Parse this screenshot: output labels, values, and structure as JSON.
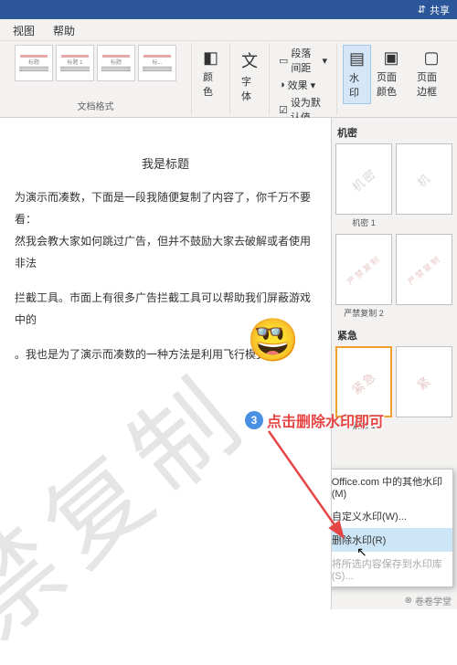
{
  "titlebar": {
    "share": "共享"
  },
  "menu": {
    "view": "视图",
    "help": "帮助"
  },
  "ribbon": {
    "style_gallery": [
      "标题",
      "标题 1",
      "标题",
      "标..."
    ],
    "doc_style_footer": "文档格式",
    "color": "颜色",
    "font": "字体",
    "para_spacing": "段落间距",
    "effect": "效果",
    "set_default": "设为默认值",
    "watermark": "水印",
    "page_color": "页面颜色",
    "page_border": "页面边框"
  },
  "doc": {
    "title": "我是标题",
    "line1": "为演示而凑数，下面是一段我随便复制了内容了，你千万不要看：",
    "line2": "然我会教大家如何跳过广告，但并不鼓励大家去破解或者使用非法",
    "line3": "拦截工具。市面上有很多广告拦截工具可以帮助我们屏蔽游戏中的",
    "line4": "。我也是为了演示而凑数的一种方法是利用飞行模式。↵",
    "bg_watermark": "禁复制"
  },
  "wm": {
    "section1": "机密",
    "thumb1_text": "机密",
    "thumb2_text": "机",
    "cap1": "机密 1",
    "thumb3_text": "严禁复制",
    "cap3": "严禁复制 2",
    "section2": "紧急",
    "thumb4_text": "紧急",
    "thumb5_text": "紧",
    "cap4": "紧急 1",
    "menu": {
      "more": "Office.com 中的其他水印(M)",
      "custom": "自定义水印(W)...",
      "remove": "删除水印(R)",
      "save": "将所选内容保存到水印库(S)..."
    }
  },
  "overlay": {
    "step_num": "3",
    "step_text": "点击删除水印即可"
  },
  "author": "卷卷学堂"
}
